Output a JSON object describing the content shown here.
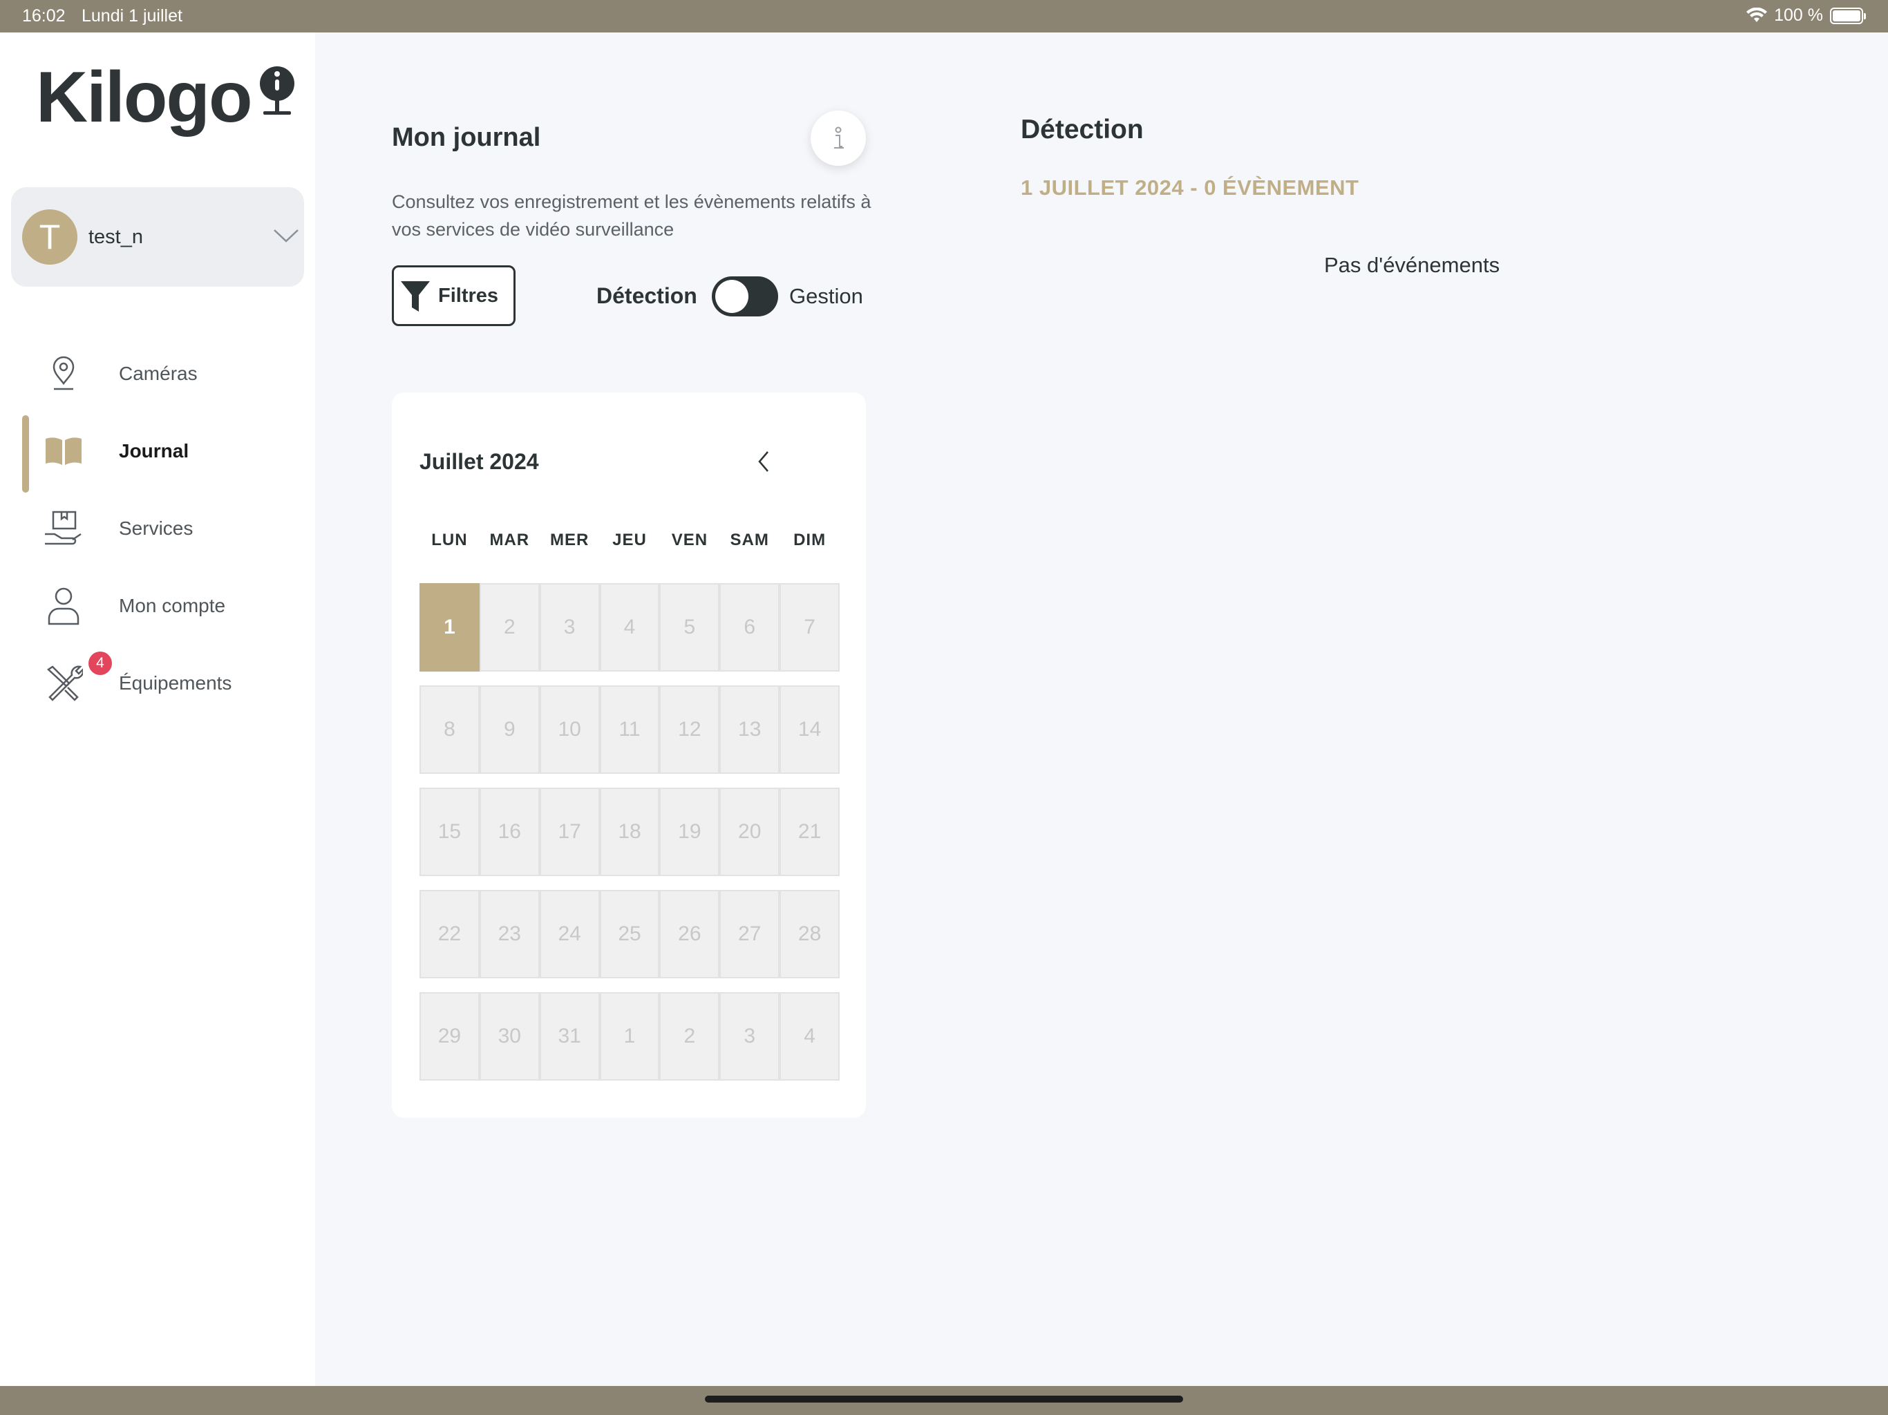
{
  "status_bar": {
    "time": "16:02",
    "date": "Lundi 1 juillet",
    "battery": "100 %"
  },
  "logo": {
    "text": "Kilogo"
  },
  "user": {
    "initial": "T",
    "name": "test_n"
  },
  "nav": [
    {
      "label": "Caméras",
      "icon": "camera-pin-icon",
      "active": false
    },
    {
      "label": "Journal",
      "icon": "book-icon",
      "active": true
    },
    {
      "label": "Services",
      "icon": "hand-package-icon",
      "active": false
    },
    {
      "label": "Mon compte",
      "icon": "user-icon",
      "active": false
    },
    {
      "label": "Équipements",
      "icon": "tools-icon",
      "active": false,
      "badge": "4"
    }
  ],
  "journal": {
    "title": "Mon journal",
    "description": "Consultez vos enregistrement et les évènements relatifs à vos services de vidéo surveillance",
    "filter_label": "Filtres",
    "toggle_left": "Détection",
    "toggle_right": "Gestion"
  },
  "calendar": {
    "month_label": "Juillet 2024",
    "weekdays": [
      "LUN",
      "MAR",
      "MER",
      "JEU",
      "VEN",
      "SAM",
      "DIM"
    ],
    "weeks": [
      [
        "1",
        "2",
        "3",
        "4",
        "5",
        "6",
        "7"
      ],
      [
        "8",
        "9",
        "10",
        "11",
        "12",
        "13",
        "14"
      ],
      [
        "15",
        "16",
        "17",
        "18",
        "19",
        "20",
        "21"
      ],
      [
        "22",
        "23",
        "24",
        "25",
        "26",
        "27",
        "28"
      ],
      [
        "29",
        "30",
        "31",
        "1",
        "2",
        "3",
        "4"
      ]
    ],
    "selected": "1"
  },
  "detection": {
    "title": "Détection",
    "date_summary": "1 JUILLET 2024  - 0 ÉVÈNEMENT",
    "empty_text": "Pas d'événements"
  },
  "colors": {
    "accent": "#bfae86",
    "dark": "#2d3436",
    "status_bar": "#8b8472",
    "badge": "#e2465c"
  }
}
